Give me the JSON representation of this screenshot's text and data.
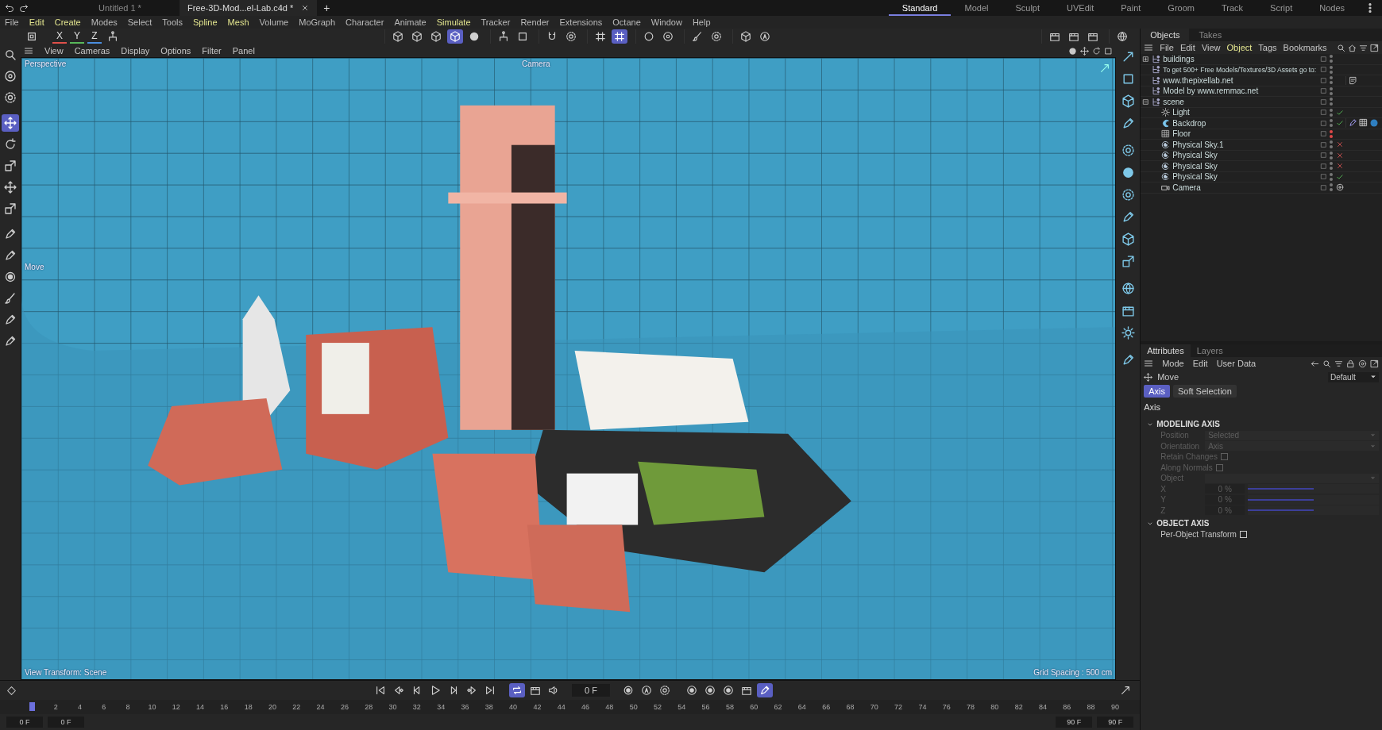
{
  "title_bar": {
    "documents": [
      {
        "title": "Untitled 1 *",
        "selected": false
      },
      {
        "title": "Free-3D-Mod...el-Lab.c4d *",
        "selected": true
      }
    ],
    "new_tab": "+",
    "workspaces": [
      {
        "label": "Standard",
        "selected": true
      },
      {
        "label": "Model",
        "selected": false
      },
      {
        "label": "Sculpt",
        "selected": false
      },
      {
        "label": "UVEdit",
        "selected": false
      },
      {
        "label": "Paint",
        "selected": false
      },
      {
        "label": "Groom",
        "selected": false
      },
      {
        "label": "Track",
        "selected": false
      },
      {
        "label": "Script",
        "selected": false
      },
      {
        "label": "Nodes",
        "selected": false
      }
    ]
  },
  "menu_bar": [
    {
      "label": "File",
      "highlighted": false
    },
    {
      "label": "Edit",
      "highlighted": true
    },
    {
      "label": "Create",
      "highlighted": true
    },
    {
      "label": "Modes",
      "highlighted": false
    },
    {
      "label": "Select",
      "highlighted": false
    },
    {
      "label": "Tools",
      "highlighted": false
    },
    {
      "label": "Spline",
      "highlighted": true
    },
    {
      "label": "Mesh",
      "highlighted": true
    },
    {
      "label": "Volume",
      "highlighted": false
    },
    {
      "label": "MoGraph",
      "highlighted": false
    },
    {
      "label": "Character",
      "highlighted": false
    },
    {
      "label": "Animate",
      "highlighted": false
    },
    {
      "label": "Simulate",
      "highlighted": true
    },
    {
      "label": "Tracker",
      "highlighted": false
    },
    {
      "label": "Render",
      "highlighted": false
    },
    {
      "label": "Extensions",
      "highlighted": false
    },
    {
      "label": "Octane",
      "highlighted": false
    },
    {
      "label": "Window",
      "highlighted": false
    },
    {
      "label": "Help",
      "highlighted": false
    }
  ],
  "toolbar": {
    "axes": [
      {
        "label": "X",
        "color": "#e0504a"
      },
      {
        "label": "Y",
        "color": "#58b85a"
      },
      {
        "label": "Z",
        "color": "#4a8ee0"
      }
    ],
    "mode_tools": [
      {
        "selected": false
      },
      {
        "selected": false
      },
      {
        "selected": false
      },
      {
        "selected": true
      },
      {
        "selected": false
      }
    ],
    "snap_tools": [
      {
        "selected": false
      },
      {
        "selected": true
      }
    ]
  },
  "left_toolbar": {
    "tools": [
      {
        "selected": false
      },
      {
        "selected": false
      },
      {
        "selected": false
      },
      {
        "selected": true
      },
      {
        "selected": false
      },
      {
        "selected": false
      },
      {
        "selected": false
      },
      {
        "selected": false
      },
      {
        "selected": false
      },
      {
        "selected": false
      },
      {
        "selected": false
      },
      {
        "selected": false
      },
      {
        "selected": false
      },
      {
        "selected": false
      }
    ]
  },
  "viewport": {
    "menu": [
      "View",
      "Cameras",
      "Display",
      "Options",
      "Filter",
      "Panel"
    ],
    "camera_name": "Perspective",
    "active_camera": "Camera",
    "tool_label": "Move",
    "view_transform": "View Transform: Scene",
    "grid_spacing": "Grid Spacing : 500 cm"
  },
  "objects_panel": {
    "tabs": [
      {
        "label": "Objects",
        "selected": true
      },
      {
        "label": "Takes",
        "selected": false
      }
    ],
    "menu": [
      {
        "label": "File",
        "highlighted": false
      },
      {
        "label": "Edit",
        "highlighted": false
      },
      {
        "label": "View",
        "highlighted": false
      },
      {
        "label": "Object",
        "highlighted": true
      },
      {
        "label": "Tags",
        "highlighted": false
      },
      {
        "label": "Bookmarks",
        "highlighted": false
      }
    ],
    "objects": [
      {
        "name": "buildings",
        "kind": "null",
        "expanded": false,
        "hidden": false
      },
      {
        "name": "To get 500+ Free Models/Textures/3D Assets go to:",
        "kind": "null",
        "hidden": false
      },
      {
        "name": "www.thepixellab.net",
        "kind": "null",
        "hidden": false,
        "tags": [
          {
            "kind": "note"
          }
        ]
      },
      {
        "name": "Model by www.remmac.net",
        "kind": "null",
        "hidden": false
      },
      {
        "name": "scene",
        "kind": "null",
        "expanded": true,
        "hidden": false,
        "children": [
          {
            "name": "Light",
            "kind": "light",
            "hidden": false,
            "enabled": true
          },
          {
            "name": "Backdrop",
            "kind": "backdrop",
            "hidden": false,
            "enabled": true,
            "tags": [
              {
                "kind": "material"
              },
              {
                "kind": "checker"
              },
              {
                "kind": "sphere"
              }
            ]
          },
          {
            "name": "Floor",
            "kind": "floor",
            "hidden": true
          },
          {
            "name": "Physical Sky.1",
            "kind": "sky",
            "hidden": false,
            "enabled": false
          },
          {
            "name": "Physical Sky",
            "kind": "sky",
            "hidden": false,
            "enabled": false
          },
          {
            "name": "Physical Sky",
            "kind": "sky",
            "hidden": false,
            "enabled": false
          },
          {
            "name": "Physical Sky",
            "kind": "sky",
            "hidden": false,
            "enabled": true
          },
          {
            "name": "Camera",
            "kind": "camera",
            "hidden": false,
            "tags": [
              {
                "kind": "target"
              }
            ]
          }
        ]
      }
    ]
  },
  "attributes_panel": {
    "tabs": [
      {
        "label": "Attributes",
        "selected": true
      },
      {
        "label": "Layers",
        "selected": false
      }
    ],
    "menu": [
      "Mode",
      "Edit",
      "User Data"
    ],
    "tool": "Move",
    "preset": "Default",
    "pages": [
      {
        "label": "Axis",
        "selected": true
      },
      {
        "label": "Soft Selection",
        "selected": false
      }
    ],
    "heading": "Axis",
    "sections": [
      {
        "title": "MODELING AXIS",
        "expanded": true,
        "fields": [
          {
            "kind": "dropdown",
            "label": "Position",
            "value": "Selected",
            "disabled": true
          },
          {
            "kind": "dropdown",
            "label": "Orientation",
            "value": "Axis",
            "disabled": true
          },
          {
            "kind": "checkbox",
            "label": "Retain Changes",
            "checked": false,
            "disabled": true
          },
          {
            "kind": "checkbox",
            "label": "Along Normals",
            "checked": false,
            "disabled": true
          },
          {
            "kind": "link",
            "label": "Object",
            "disabled": true
          },
          {
            "kind": "slider",
            "label": "X",
            "value": "0 %",
            "level": 0.5,
            "disabled": true
          },
          {
            "kind": "slider",
            "label": "Y",
            "value": "0 %",
            "level": 0.5,
            "disabled": true
          },
          {
            "kind": "slider",
            "label": "Z",
            "value": "0 %",
            "level": 0.5,
            "disabled": true
          }
        ]
      },
      {
        "title": "OBJECT AXIS",
        "expanded": true,
        "fields": [
          {
            "kind": "checkbox",
            "label": "Per-Object Transform",
            "checked": false,
            "disabled": false
          }
        ]
      }
    ]
  },
  "timeline": {
    "frame": "0 F",
    "loop": true,
    "key_tools": [
      {
        "selected": false
      },
      {
        "selected": false
      },
      {
        "selected": false
      },
      {
        "selected": false
      },
      {
        "selected": true
      }
    ],
    "ticks": [
      "2",
      "4",
      "6",
      "8",
      "10",
      "12",
      "14",
      "16",
      "18",
      "20",
      "22",
      "24",
      "26",
      "28",
      "30",
      "32",
      "34",
      "36",
      "38",
      "40",
      "42",
      "44",
      "46",
      "48",
      "50",
      "52",
      "54",
      "56",
      "58",
      "60",
      "62",
      "64",
      "66",
      "68",
      "70",
      "72",
      "74",
      "76",
      "78",
      "80",
      "82",
      "84",
      "86",
      "88",
      "90"
    ],
    "start": "0 F",
    "preview_start": "0 F",
    "preview_end": "90 F",
    "end": "90 F"
  }
}
